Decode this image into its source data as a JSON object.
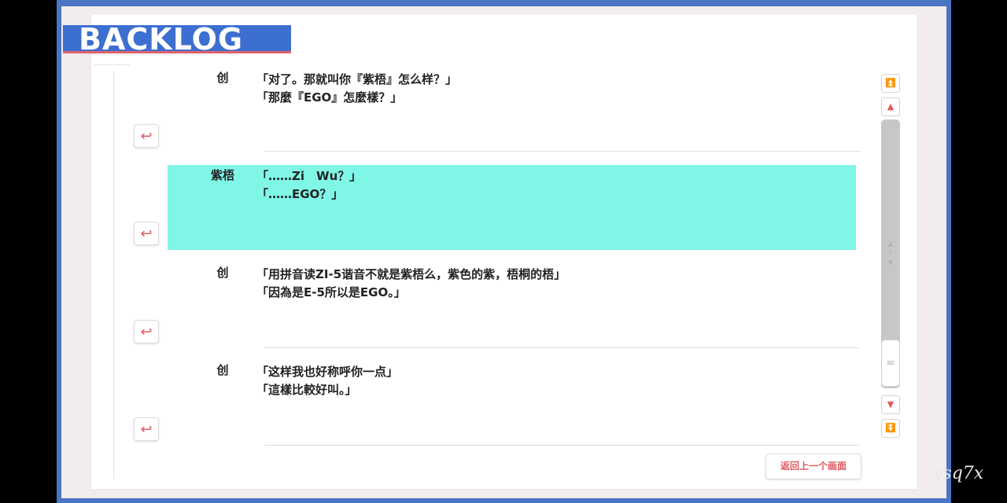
{
  "header": {
    "title": "BACKLOG"
  },
  "entries": [
    {
      "speaker": "创",
      "line_cn": "「对了。那就叫你『紫梧』怎么样？」",
      "line_tw": "「那麼『EGO』怎麼樣？」",
      "active": false
    },
    {
      "speaker": "紫梧",
      "line_cn": "「……Zi　Wu？」",
      "line_tw": "「……EGO？」",
      "active": true
    },
    {
      "speaker": "创",
      "line_cn": "「用拼音读ZI-5谐音不就是紫梧么，紫色的紫，梧桐的梧」",
      "line_tw": "「因為是E-5所以是EGO。」",
      "active": false
    },
    {
      "speaker": "创",
      "line_cn": "「这样我也好称呼你一点」",
      "line_tw": "「這樣比較好叫。」",
      "active": false
    }
  ],
  "icons": {
    "replay": "replay-voice-icon",
    "scroll_top": "double-up-icon",
    "scroll_up": "up-icon",
    "scroll_down": "down-icon",
    "scroll_bottom": "double-down-icon"
  },
  "scrollbar": {
    "position": 1.0
  },
  "footer": {
    "back_label": "返回上一个画面"
  },
  "watermark": "ysq7x",
  "colors": {
    "accent_blue": "#3d6fd0",
    "accent_red": "#e05a60",
    "highlight": "#7ff6e6",
    "border": "#4a74c4"
  }
}
